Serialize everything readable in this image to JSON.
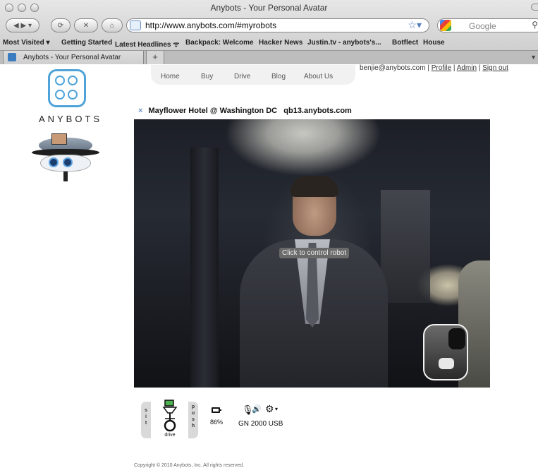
{
  "browser": {
    "window_title": "Anybots - Your Personal Avatar",
    "url": "http://www.anybots.com/#myrobots",
    "search_placeholder": "Google",
    "bookmarks": [
      "Most Visited ▾",
      "Getting Started",
      "Latest Headlines ᯤ",
      "Backpack: Welcome",
      "Hacker News",
      "Justin.tv - anybots's...",
      "Botflect",
      "House"
    ],
    "tabs": [
      {
        "label": "Anybots - Your Personal Avatar"
      }
    ],
    "new_tab_label": "+"
  },
  "logo": {
    "text": "ANYBOTS",
    "accent": "#4fa3d8"
  },
  "site_nav": {
    "items": [
      "Home",
      "Buy",
      "Drive",
      "Blog",
      "About Us"
    ]
  },
  "user": {
    "email": "benjie@anybots.com",
    "separator": "|",
    "links": [
      "Profile",
      "Admin",
      "Sign out"
    ]
  },
  "robot_panel": {
    "close_glyph": "×",
    "title": "Mayflower Hotel @ Washington DC   qb13.anybots.com",
    "video_tooltip": "Click to control robot"
  },
  "controls": {
    "sit_label": [
      "s",
      "i",
      "t"
    ],
    "push_label": [
      "p",
      "u",
      "s",
      "h"
    ],
    "drive_label": "drive",
    "battery_percent": "86%",
    "device_name": "GN 2000 USB",
    "icons": [
      "battery-icon",
      "microphone-icon",
      "speaker-icon",
      "gear-icon"
    ]
  },
  "footer": {
    "copyright": "Copyright © 2010 Anybots, Inc. All rights reserved."
  }
}
